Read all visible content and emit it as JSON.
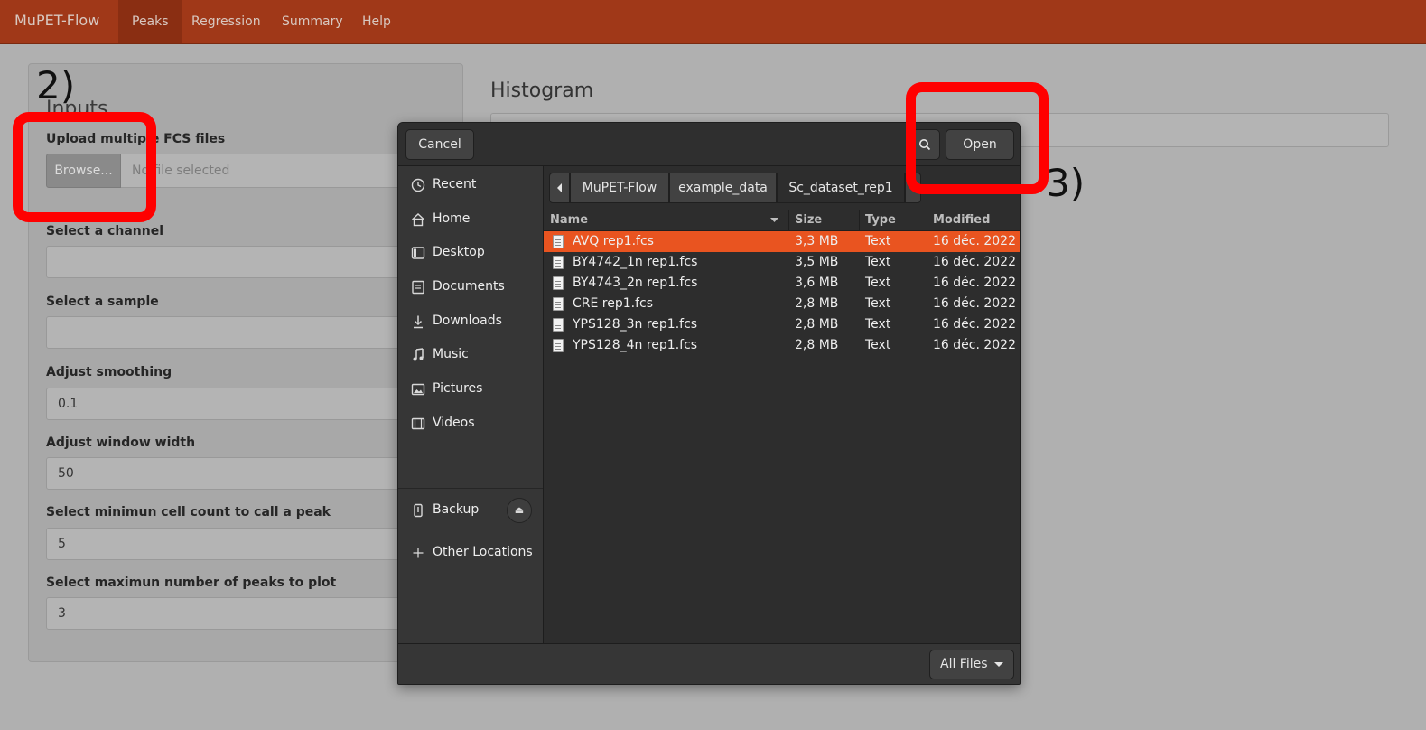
{
  "navbar": {
    "brand": "MuPET-Flow",
    "tabs": [
      "Peaks",
      "Regression",
      "Summary",
      "Help"
    ],
    "active_tab": "Peaks"
  },
  "sidebar": {
    "title": "Inputs",
    "upload_label": "Upload multiple FCS files",
    "browse_label": "Browse...",
    "file_status": "No file selected",
    "channel_label": "Select a channel",
    "channel_value": "",
    "sample_label": "Select a sample",
    "sample_value": "",
    "smoothing_label": "Adjust smoothing",
    "smoothing_value": "0.1",
    "window_label": "Adjust window width",
    "window_value": "50",
    "min_count_label": "Select minimun cell count to call a peak",
    "min_count_value": "5",
    "max_peaks_label": "Select maximun number of peaks to plot",
    "max_peaks_value": "3"
  },
  "main": {
    "histogram_title": "Histogram"
  },
  "annotations": {
    "step2": "2)",
    "step3": "3)",
    "highlight_color": "#ff0000"
  },
  "dialog": {
    "cancel_label": "Cancel",
    "open_label": "Open",
    "search_icon": "search-icon",
    "places": [
      {
        "icon": "clock-icon",
        "label": "Recent"
      },
      {
        "icon": "home-icon",
        "label": "Home"
      },
      {
        "icon": "desktop-icon",
        "label": "Desktop"
      },
      {
        "icon": "documents-icon",
        "label": "Documents"
      },
      {
        "icon": "download-icon",
        "label": "Downloads"
      },
      {
        "icon": "music-icon",
        "label": "Music"
      },
      {
        "icon": "pictures-icon",
        "label": "Pictures"
      },
      {
        "icon": "videos-icon",
        "label": "Videos"
      },
      {
        "icon": "usb-drive-icon",
        "label": "Backup"
      },
      {
        "icon": "plus-icon",
        "label": "Other Locations"
      }
    ],
    "path": [
      "MuPET-Flow",
      "example_data",
      "Sc_dataset_rep1"
    ],
    "columns": [
      "Name",
      "Size",
      "Type",
      "Modified"
    ],
    "files": [
      {
        "name": "AVQ rep1.fcs",
        "size": "3,3 MB",
        "type": "Text",
        "modified": "16 déc. 2022",
        "selected": true
      },
      {
        "name": "BY4742_1n rep1.fcs",
        "size": "3,5 MB",
        "type": "Text",
        "modified": "16 déc. 2022",
        "selected": false
      },
      {
        "name": "BY4743_2n rep1.fcs",
        "size": "3,6 MB",
        "type": "Text",
        "modified": "16 déc. 2022",
        "selected": false
      },
      {
        "name": "CRE rep1.fcs",
        "size": "2,8 MB",
        "type": "Text",
        "modified": "16 déc. 2022",
        "selected": false
      },
      {
        "name": "YPS128_3n rep1.fcs",
        "size": "2,8 MB",
        "type": "Text",
        "modified": "16 déc. 2022",
        "selected": false
      },
      {
        "name": "YPS128_4n rep1.fcs",
        "size": "2,8 MB",
        "type": "Text",
        "modified": "16 déc. 2022",
        "selected": false
      }
    ],
    "filter_label": "All Files",
    "selection_color": "#e95420"
  }
}
